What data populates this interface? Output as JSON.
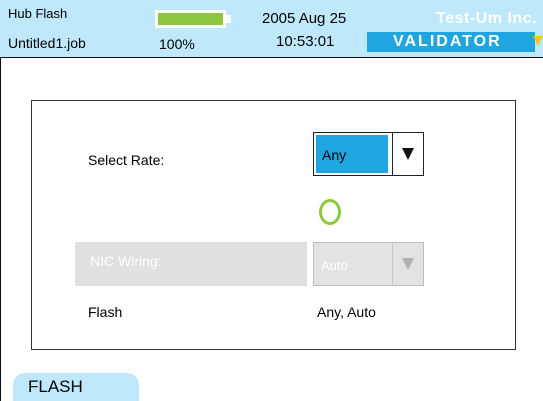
{
  "header": {
    "app_title": "Hub Flash",
    "job_name": "Untitled1.job",
    "battery": {
      "percent_label": "100%",
      "level": 1.0,
      "color": "#8dc63f"
    },
    "date": "2005 Aug 25",
    "time": "10:53:01",
    "brand_name": "Test-Um Inc.",
    "product_name": "VALIDATOR"
  },
  "form": {
    "select_rate_label": "Select Rate:",
    "rate_value": "Any",
    "nic_wiring_label": "NIC Wiring:",
    "nic_wiring_value": "Auto",
    "summary_label": "Flash",
    "summary_value": "Any, Auto"
  },
  "footer": {
    "flash_button_label": "FLASH"
  },
  "colors": {
    "header_bg": "#bfe8fb",
    "accent_blue": "#1fa6e0",
    "status_green": "#8dc63f",
    "brand_triangle": "#f5c518"
  }
}
